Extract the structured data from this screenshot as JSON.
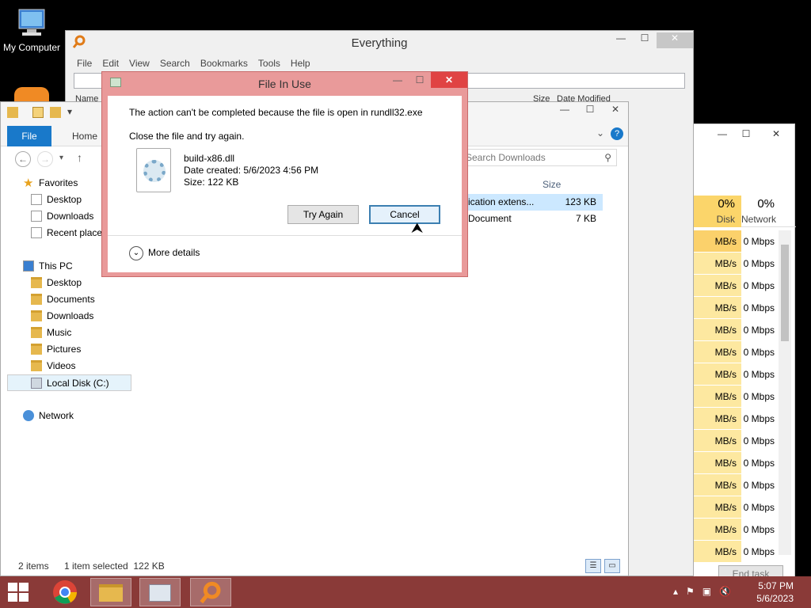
{
  "desktop": {
    "icon_label": "My Computer"
  },
  "everything": {
    "title": "Everything",
    "menu": [
      "File",
      "Edit",
      "View",
      "Search",
      "Bookmarks",
      "Tools",
      "Help"
    ],
    "columns": {
      "name": "Name",
      "size": "Size",
      "date_modified": "Date Modified"
    }
  },
  "explorer": {
    "ribbon_file": "File",
    "ribbon_home": "Home",
    "search_placeholder": "Search Downloads",
    "nav": {
      "favorites": "Favorites",
      "fav_items": [
        "Desktop",
        "Downloads",
        "Recent places"
      ],
      "this_pc": "This PC",
      "pc_items": [
        "Desktop",
        "Documents",
        "Downloads",
        "Music",
        "Pictures",
        "Videos",
        "Local Disk (C:)"
      ],
      "network": "Network"
    },
    "list_header_size": "Size",
    "rows": [
      {
        "type": "ication extens...",
        "size": "123 KB"
      },
      {
        "type": "Document",
        "size": "7 KB"
      }
    ],
    "status": {
      "items": "2 items",
      "selected": "1 item selected  122 KB"
    }
  },
  "taskmgr": {
    "disk_pct": "0%",
    "disk_label": "Disk",
    "net_pct": "0%",
    "net_label": "Network",
    "rows": [
      {
        "disk": "MB/s",
        "net": "0 Mbps"
      },
      {
        "disk": "MB/s",
        "net": "0 Mbps"
      },
      {
        "disk": "MB/s",
        "net": "0 Mbps"
      },
      {
        "disk": "MB/s",
        "net": "0 Mbps"
      },
      {
        "disk": "MB/s",
        "net": "0 Mbps"
      },
      {
        "disk": "MB/s",
        "net": "0 Mbps"
      },
      {
        "disk": "MB/s",
        "net": "0 Mbps"
      },
      {
        "disk": "MB/s",
        "net": "0 Mbps"
      },
      {
        "disk": "MB/s",
        "net": "0 Mbps"
      },
      {
        "disk": "MB/s",
        "net": "0 Mbps"
      },
      {
        "disk": "MB/s",
        "net": "0 Mbps"
      },
      {
        "disk": "MB/s",
        "net": "0 Mbps"
      },
      {
        "disk": "MB/s",
        "net": "0 Mbps"
      },
      {
        "disk": "MB/s",
        "net": "0 Mbps"
      },
      {
        "disk": "MB/s",
        "net": "0 Mbps"
      }
    ],
    "end_task": "End task"
  },
  "dialog": {
    "title": "File In Use",
    "message": "The action can't be completed because the file is open in rundll32.exe",
    "instruction": "Close the file and try again.",
    "file_name": "build-x86.dll",
    "date_created": "Date created: 5/6/2023 4:56 PM",
    "size": "Size: 122 KB",
    "try_again": "Try Again",
    "cancel": "Cancel",
    "more_details": "More details"
  },
  "taskbar": {
    "time": "5:07 PM",
    "date": "5/6/2023"
  },
  "colors": {
    "dialog_frame": "#e99a9a",
    "taskbar": "#8a3a38",
    "accent": "#1979ca"
  }
}
